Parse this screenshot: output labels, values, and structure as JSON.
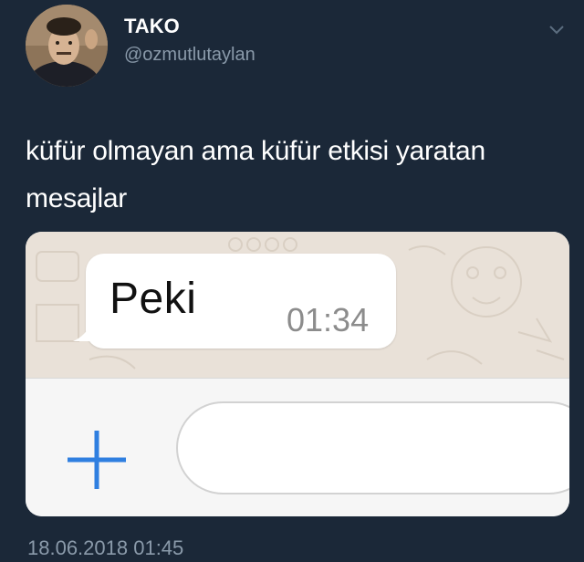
{
  "user": {
    "name": "TAKO",
    "handle": "@ozmutlutaylan"
  },
  "tweet": {
    "text": "küfür olmayan ama küfür etkisi yaratan mesajlar",
    "timestamp": "18.06.2018 01:45"
  },
  "chat_screenshot": {
    "message": "Peki",
    "time": "01:34"
  },
  "colors": {
    "background": "#1b2838",
    "plus_icon": "#2f7fe0"
  },
  "icons": {
    "chevron": "chevron-down-icon",
    "plus": "plus-icon"
  }
}
